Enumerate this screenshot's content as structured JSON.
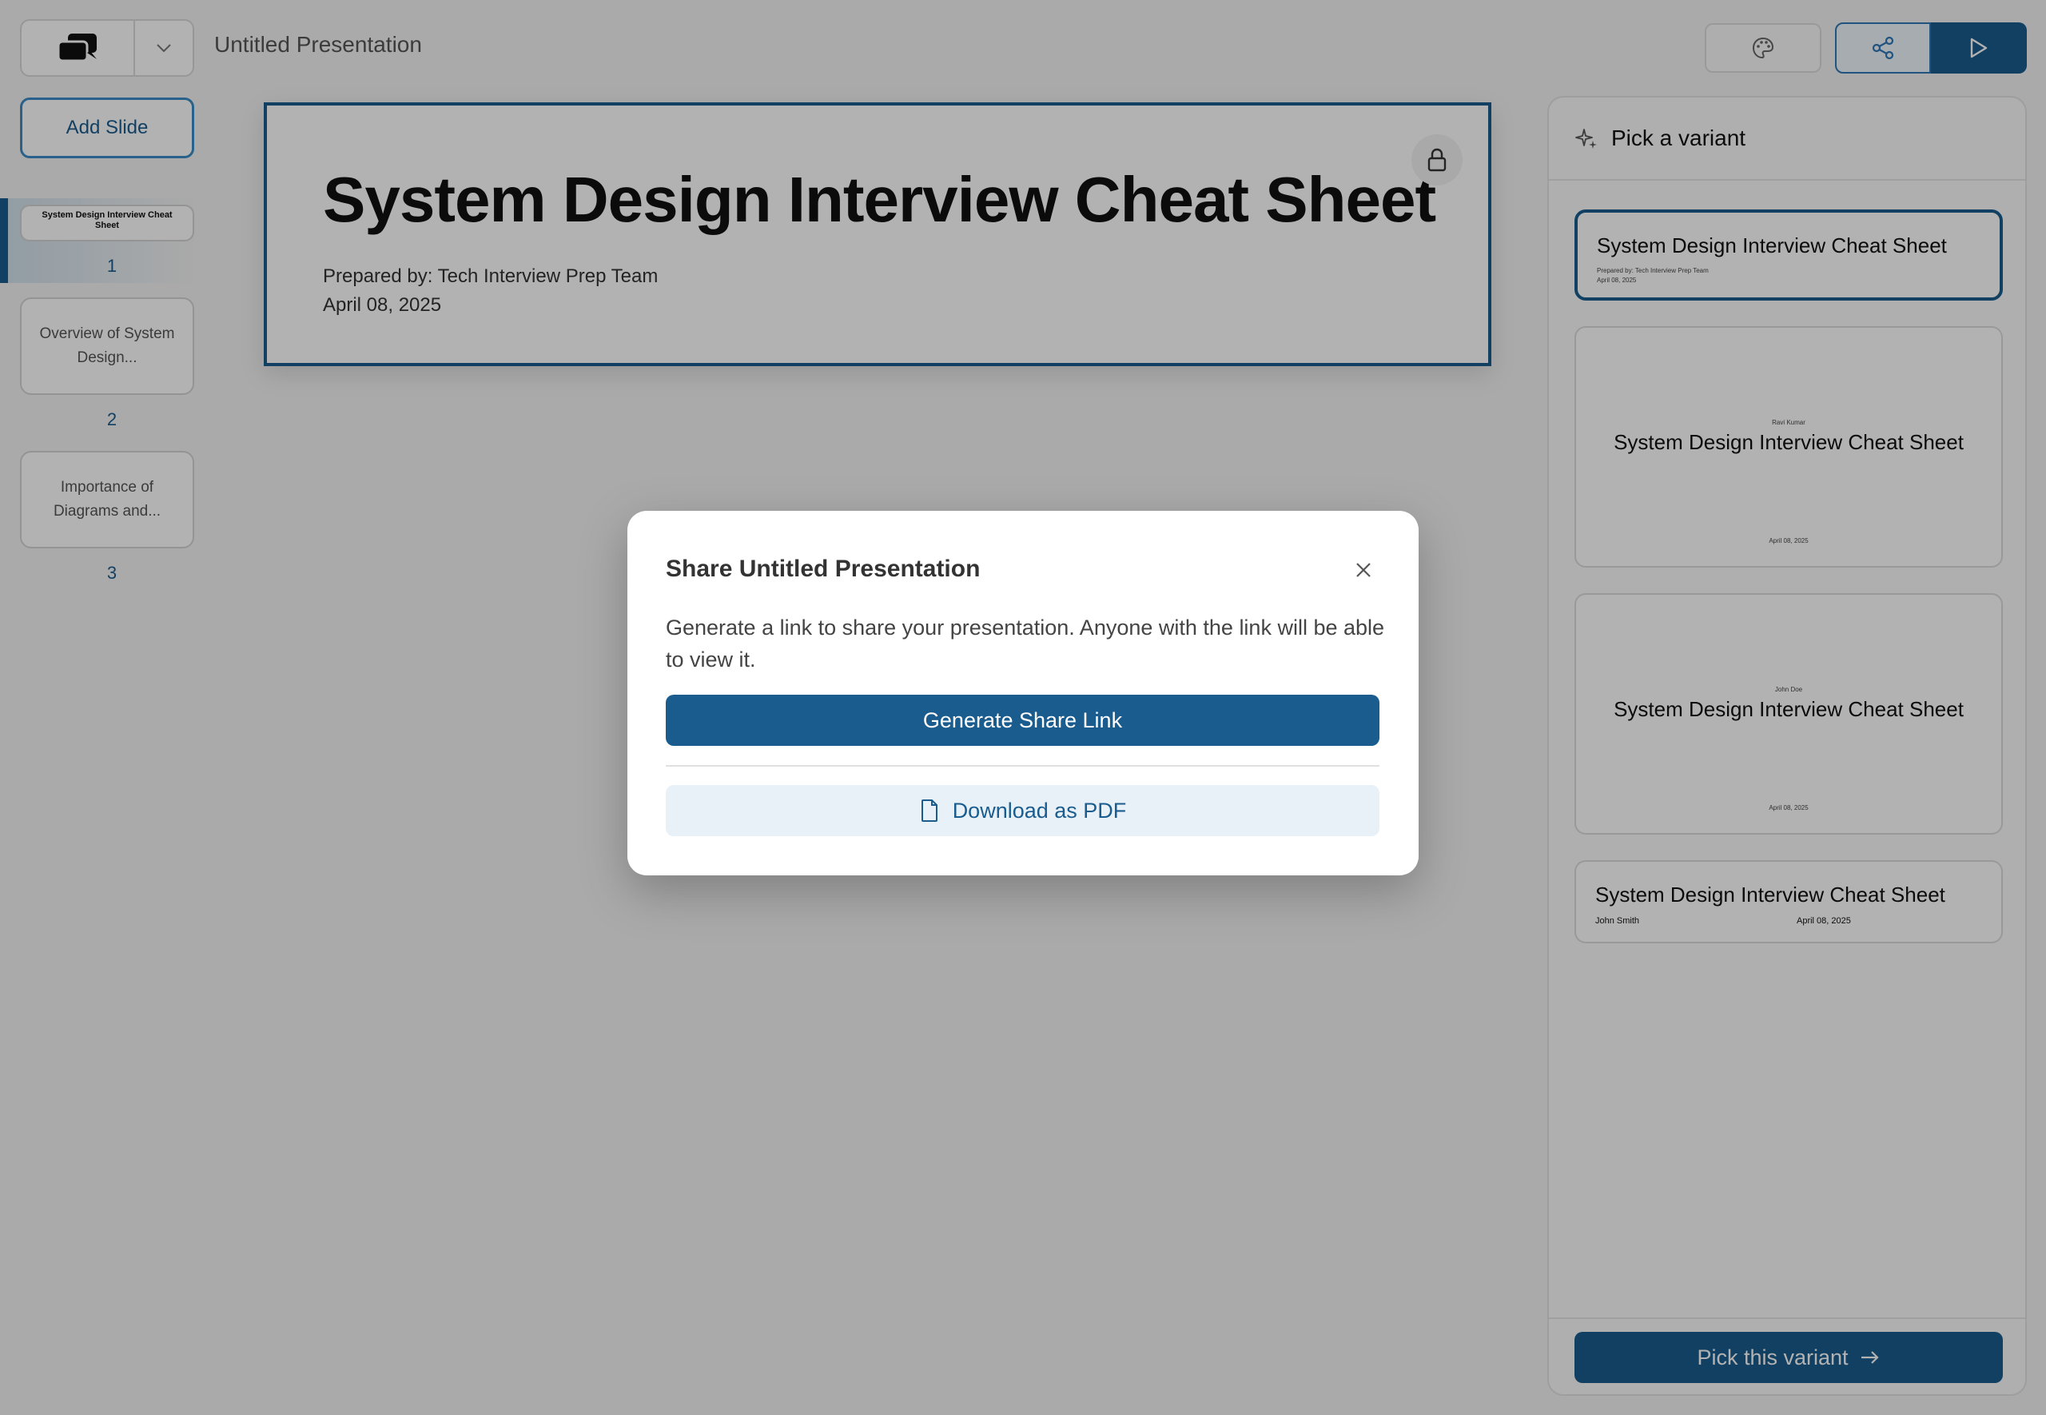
{
  "header": {
    "doc_title": "Untitled Presentation",
    "logo_icon": "chat-bubbles-logo",
    "dropdown_icon": "chevron-down-icon",
    "theme_icon": "palette-icon",
    "share_icon": "share-icon",
    "present_icon": "play-icon"
  },
  "sidebar": {
    "add_slide_label": "Add Slide",
    "slides": [
      {
        "number": "1",
        "label": "System Design Interview Cheat Sheet"
      },
      {
        "number": "2",
        "label": "Overview of System Design..."
      },
      {
        "number": "3",
        "label": "Importance of Diagrams and..."
      }
    ]
  },
  "slide": {
    "title": "System Design Interview Cheat Sheet",
    "prepared_by": "Prepared by: Tech Interview Prep Team",
    "date": "April 08, 2025",
    "lock_icon": "lock-icon"
  },
  "variant_panel": {
    "title": "Pick a variant",
    "icon": "sparkles-icon",
    "variants": [
      {
        "title": "System Design Interview Cheat Sheet",
        "line1": "Prepared by: Tech Interview Prep Team",
        "line2": "April 08, 2025"
      },
      {
        "title": "System Design Interview Cheat Sheet",
        "author": "Ravi Kumar",
        "date": "April 08, 2025"
      },
      {
        "title": "System Design Interview Cheat Sheet",
        "author": "John Doe",
        "date": "April 08, 2025"
      },
      {
        "title": "System Design Interview Cheat Sheet",
        "author": "John Smith",
        "date": "April 08, 2025"
      }
    ],
    "pick_button": "Pick this variant",
    "pick_icon": "arrow-right-icon"
  },
  "modal": {
    "title": "Share Untitled Presentation",
    "description": "Generate a link to share your presentation. Anyone with the link will be able to view it.",
    "generate_button": "Generate Share Link",
    "download_button": "Download as PDF",
    "close_icon": "close-icon",
    "file_icon": "file-icon"
  },
  "colors": {
    "accent": "#1a5c8e",
    "accent_light": "#e8f1f8",
    "overlay": "rgba(0,0,0,0.30)"
  }
}
